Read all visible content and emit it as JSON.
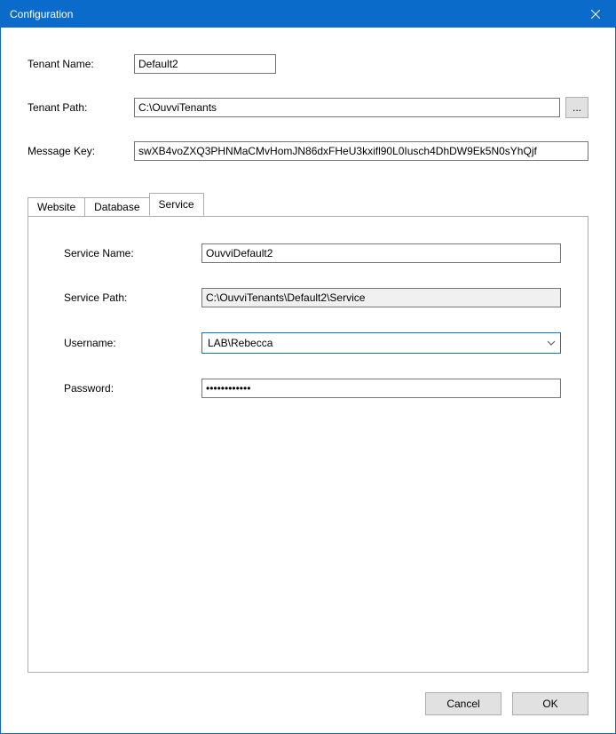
{
  "window": {
    "title": "Configuration"
  },
  "form": {
    "tenant_name_label": "Tenant Name:",
    "tenant_name_value": "Default2",
    "tenant_path_label": "Tenant Path:",
    "tenant_path_value": "C:\\OuvviTenants",
    "browse_label": "...",
    "message_key_label": "Message Key:",
    "message_key_value": "swXB4voZXQ3PHNMaCMvHomJN86dxFHeU3kxifl90L0Iusch4DhDW9Ek5N0sYhQjf"
  },
  "tabs": {
    "website": "Website",
    "database": "Database",
    "service": "Service",
    "active": "service"
  },
  "service_panel": {
    "service_name_label": "Service Name:",
    "service_name_value": "OuvviDefault2",
    "service_path_label": "Service Path:",
    "service_path_value": "C:\\OuvviTenants\\Default2\\Service",
    "username_label": "Username:",
    "username_value": "LAB\\Rebecca",
    "password_label": "Password:",
    "password_value": "••••••••••••"
  },
  "footer": {
    "cancel": "Cancel",
    "ok": "OK"
  }
}
